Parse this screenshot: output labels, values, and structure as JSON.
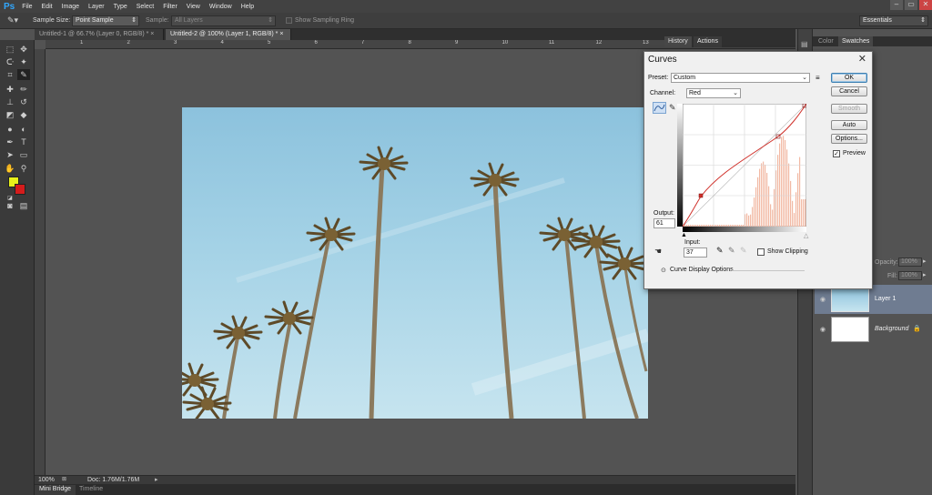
{
  "app": {
    "logo": "Ps"
  },
  "menu": [
    "File",
    "Edit",
    "Image",
    "Layer",
    "Type",
    "Select",
    "Filter",
    "View",
    "Window",
    "Help"
  ],
  "window_controls": {
    "minimize": "–",
    "maximize": "▭",
    "close": "✕"
  },
  "options_bar": {
    "sample_size_label": "Sample Size:",
    "sample_size_value": "Point Sample",
    "sample_label": "Sample:",
    "sample_value": "All Layers",
    "show_ring_label": "Show Sampling Ring",
    "workspace": "Essentials"
  },
  "doc_tabs": [
    {
      "label": "Untitled-1 @ 66.7% (Layer 0, RGB/8) *",
      "close": "×"
    },
    {
      "label": "Untitled-2 @ 100% (Layer 1, RGB/8) *",
      "close": "×"
    }
  ],
  "ruler_h_ticks": [
    "1",
    "2",
    "3",
    "4",
    "5",
    "6",
    "7",
    "8",
    "9",
    "10",
    "11",
    "12",
    "13"
  ],
  "status": {
    "zoom": "100%",
    "doc": "Doc: 1.76M/1.76M"
  },
  "bottom_tabs": [
    "Mini Bridge",
    "Timeline"
  ],
  "panels": {
    "history_tabs": [
      "History",
      "Actions"
    ],
    "color_tabs": [
      "Color",
      "Swatches"
    ],
    "opacity_label": "Opacity:",
    "opacity_value": "100%",
    "fill_label": "Fill:",
    "fill_value": "100%",
    "layers": [
      {
        "name": "Layer 1"
      },
      {
        "name": "Background"
      }
    ]
  },
  "colors": {
    "foreground": "#e8f01a",
    "background": "#d41c1c",
    "curve": "#d0302a",
    "histogram": "#f2b9a4"
  },
  "curves": {
    "title": "Curves",
    "preset_label": "Preset:",
    "preset_value": "Custom",
    "channel_label": "Channel:",
    "channel_value": "Red",
    "output_label": "Output:",
    "output_value": "61",
    "input_label": "Input:",
    "input_value": "37",
    "show_clipping": "Show Clipping",
    "display_options": "Curve Display Options",
    "buttons": {
      "ok": "OK",
      "cancel": "Cancel",
      "smooth": "Smooth",
      "auto": "Auto",
      "options": "Options..."
    },
    "preview_label": "Preview",
    "preview_checked": "✓"
  }
}
